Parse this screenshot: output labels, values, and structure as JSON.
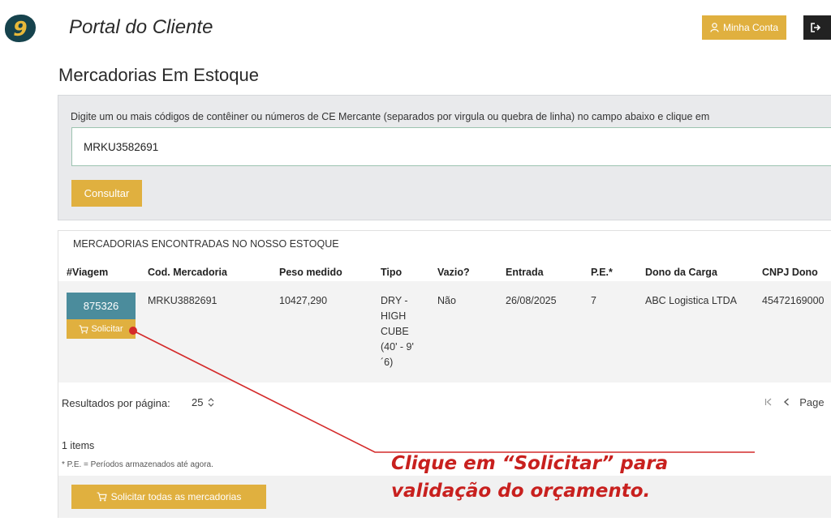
{
  "step_number": "9",
  "header": {
    "app_title": "Portal do Cliente",
    "account_button": "Minha Conta"
  },
  "page_title": "Mercadorias Em Estoque",
  "search": {
    "instructions": "Digite um ou mais códigos de contêiner ou números de CE Mercante (separados por virgula ou quebra de linha) no campo abaixo e clique em",
    "input_value": "MRKU3582691",
    "submit_label": "Consultar"
  },
  "results": {
    "header": "MERCADORIAS ENCONTRADAS NO NOSSO ESTOQUE",
    "columns": [
      "#Viagem",
      "Cod. Mercadoria",
      "Peso medido",
      "Tipo",
      "Vazio?",
      "Entrada",
      "P.E.*",
      "Dono da Carga",
      "CNPJ Dono"
    ],
    "rows": [
      {
        "voyage": "875326",
        "request_label": "Solicitar",
        "code": "MRKU3882691",
        "weight": "10427,290",
        "type": "DRY - HIGH CUBE (40' - 9' ´6)",
        "empty": "Não",
        "entry": "26/08/2025",
        "pe": "7",
        "owner": "ABC Logistica LTDA",
        "cnpj": "45472169000"
      }
    ],
    "per_page_label": "Resultados por página:",
    "per_page_value": "25",
    "pager_text": "Page",
    "count_text": "1 items",
    "footnote": "* P.E. = Períodos armazenados até agora.",
    "request_all_label": "Solicitar todas as mercadorias"
  },
  "annotation": {
    "prefix": "Clique em “",
    "highlight": "Solicitar",
    "suffix": "” para",
    "line2": "validação do orçamento."
  },
  "colors": {
    "accent": "#e0b03f",
    "voyage_badge": "#4b8c9c",
    "annotation": "#c8201e",
    "step_badge_bg": "#16434d"
  }
}
